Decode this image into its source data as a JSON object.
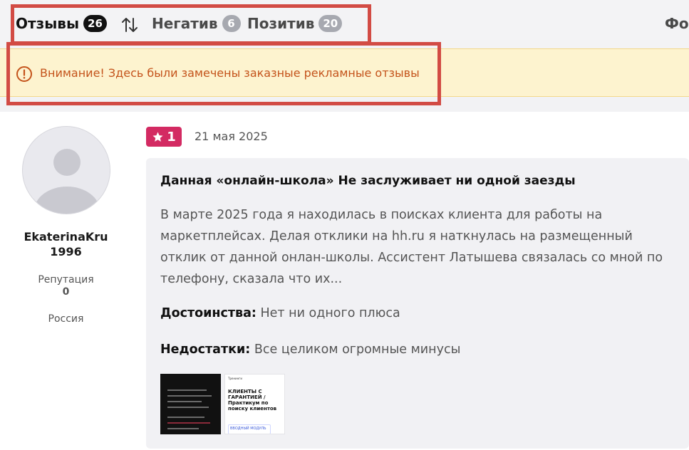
{
  "tabs": {
    "reviews": {
      "label": "Отзывы",
      "count": "26"
    },
    "negative": {
      "label": "Негатив",
      "count": "6"
    },
    "positive": {
      "label": "Позитив",
      "count": "20"
    },
    "extra": {
      "label": "Фо"
    }
  },
  "warning": {
    "text": "Внимание! Здесь были замечены заказные рекламные отзывы"
  },
  "review": {
    "author": {
      "name_line1": "EkaterinaKru",
      "name_line2": "1996",
      "reputation_label": "Репутация",
      "reputation_value": "0",
      "country": "Россия"
    },
    "rating": "1",
    "date": "21 мая 2025",
    "title": "Данная «онлайн-школа» Не заслуживает ни одной заезды",
    "text": "В марте 2025 года я находилась в поисках клиента для работы на маркетплейсах. Делая отклики на hh.ru я наткнулась на размещенный отклик от данной онлан-школы. Ассистент Латышева связалась со мной по телефону, сказала что их...",
    "pros_label": "Достоинства:",
    "pros": "Нет ни одного плюса",
    "cons_label": "Недостатки:",
    "cons": "Все целиком огромные минусы",
    "attachments": [
      {
        "title": ""
      },
      {
        "top": "Тренинги",
        "title": "КЛИЕНТЫ С ГАРАНТИЕЙ / Практикум по поиску клиентов",
        "button": "ВВОДНЫЙ МОДУЛЬ"
      }
    ]
  },
  "colors": {
    "rating_badge": "#d32a62",
    "warning_bg": "#fdf3cf",
    "warning_text": "#c4531b",
    "highlight": "#d24b44"
  }
}
